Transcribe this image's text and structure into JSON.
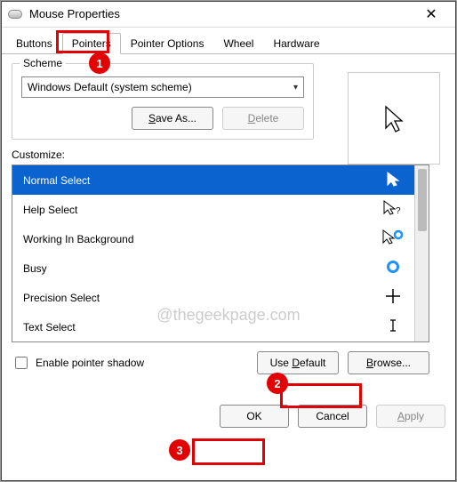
{
  "window": {
    "title": "Mouse Properties",
    "close_glyph": "✕"
  },
  "tabs": {
    "items": [
      {
        "label": "Buttons"
      },
      {
        "label": "Pointers"
      },
      {
        "label": "Pointer Options"
      },
      {
        "label": "Wheel"
      },
      {
        "label": "Hardware"
      }
    ],
    "active_index": 1
  },
  "scheme": {
    "legend": "Scheme",
    "selected": "Windows Default (system scheme)",
    "save_as_label": "Save As...",
    "delete_label": "Delete"
  },
  "customize": {
    "label": "Customize:",
    "items": [
      {
        "label": "Normal Select",
        "selected": true,
        "glyph": "arrow-white"
      },
      {
        "label": "Help Select",
        "selected": false,
        "glyph": "arrow-help"
      },
      {
        "label": "Working In Background",
        "selected": false,
        "glyph": "arrow-ring"
      },
      {
        "label": "Busy",
        "selected": false,
        "glyph": "ring"
      },
      {
        "label": "Precision Select",
        "selected": false,
        "glyph": "cross"
      },
      {
        "label": "Text Select",
        "selected": false,
        "glyph": "ibeam"
      }
    ]
  },
  "pointer_shadow": {
    "label": "Enable pointer shadow",
    "checked": false
  },
  "buttons": {
    "use_default": "Use Default",
    "browse": "Browse...",
    "ok": "OK",
    "cancel": "Cancel",
    "apply": "Apply"
  },
  "watermark": "@thegeekpage.com",
  "annotations": {
    "n1": "1",
    "n2": "2",
    "n3": "3"
  }
}
